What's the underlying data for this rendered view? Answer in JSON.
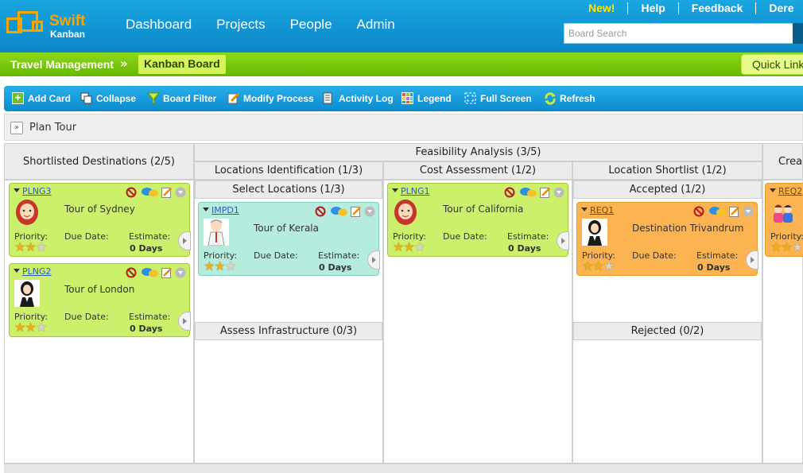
{
  "header": {
    "logo_line1": "Swift",
    "logo_line2": "Kanban",
    "nav": [
      "Dashboard",
      "Projects",
      "People",
      "Admin"
    ],
    "top_links": [
      "New!",
      "Help",
      "Feedback",
      "Dere"
    ],
    "search_placeholder": "Board Search"
  },
  "breadcrumb": {
    "project": "Travel Management",
    "separator": "»",
    "current": "Kanban Board",
    "quick_links": "Quick Link"
  },
  "toolbar": [
    {
      "label": "Add Card",
      "icon": "add-icon"
    },
    {
      "label": "Collapse",
      "icon": "collapse-icon"
    },
    {
      "label": "Board Filter",
      "icon": "filter-icon"
    },
    {
      "label": "Modify Process",
      "icon": "edit-process-icon"
    },
    {
      "label": "Activity Log",
      "icon": "log-icon"
    },
    {
      "label": "Legend",
      "icon": "legend-icon"
    },
    {
      "label": "Full Screen",
      "icon": "fullscreen-icon"
    },
    {
      "label": "Refresh",
      "icon": "refresh-icon"
    }
  ],
  "board": {
    "name": "Plan Tour"
  },
  "columns": {
    "shortlisted": "Shortlisted Destinations (2/5)",
    "feasibility": "Feasibility Analysis (3/5)",
    "locations_id": "Locations Identification (1/3)",
    "cost": "Cost Assessment (1/2)",
    "loc_shortlist": "Location Shortlist (1/2)",
    "creat": "Creat",
    "select_locations": "Select Locations (1/3)",
    "assess_infra": "Assess Infrastructure (0/3)",
    "accepted": "Accepted (1/2)",
    "rejected": "Rejected (0/2)"
  },
  "card_labels": {
    "priority": "Priority:",
    "due": "Due Date:",
    "estimate": "Estimate:",
    "days": "0 Days"
  },
  "cards": [
    {
      "id": "PLNG3",
      "title": "Tour of Sydney",
      "color": "#ccef6c",
      "avatar": "woman-red-hair",
      "stars": 2
    },
    {
      "id": "PLNG2",
      "title": "Tour of London",
      "color": "#ccef6c",
      "avatar": "woman-black-hair",
      "stars": 2
    },
    {
      "id": "IMPD1",
      "title": "Tour of Kerala",
      "color": "#b5ecde",
      "avatar": "doctor",
      "stars": 2
    },
    {
      "id": "PLNG1",
      "title": "Tour of California",
      "color": "#ccef6c",
      "avatar": "woman-red-hair",
      "stars": 2
    },
    {
      "id": "REQ1",
      "title": "Destination Trivandrum",
      "color": "#fbb451",
      "avatar": "woman-black-hair",
      "stars": 2
    },
    {
      "id": "REQ2",
      "title": "",
      "color": "#fbb451",
      "avatar": "group",
      "stars": 2
    }
  ],
  "colors": {
    "header_blue": "#0b86c6",
    "accent_orange": "#f7a600",
    "green_bar": "#66b800"
  }
}
